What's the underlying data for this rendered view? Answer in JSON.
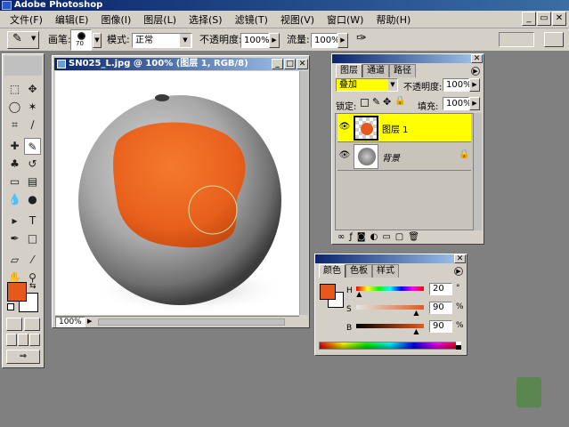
{
  "app": {
    "title": "Adobe Photoshop"
  },
  "menu": [
    "文件(F)",
    "编辑(E)",
    "图像(I)",
    "图层(L)",
    "选择(S)",
    "滤镜(T)",
    "视图(V)",
    "窗口(W)",
    "帮助(H)"
  ],
  "options": {
    "brush_label": "画笔:",
    "brush_size": "70",
    "mode_label": "模式:",
    "mode_value": "正常",
    "opacity_label": "不透明度:",
    "opacity_value": "100%",
    "flow_label": "流量:",
    "flow_value": "100%"
  },
  "document": {
    "title": "SN025_L.jpg @ 100% (图层 1, RGB/8)",
    "zoom": "100%"
  },
  "layers_panel": {
    "tabs": [
      "图层",
      "通道",
      "路径"
    ],
    "blend_mode": "叠加",
    "opacity_label": "不透明度:",
    "opacity_value": "100%",
    "lock_label": "锁定:",
    "fill_label": "填充:",
    "fill_value": "100%",
    "layers": [
      {
        "name": "图层 1",
        "selected": true
      },
      {
        "name": "背景",
        "selected": false
      }
    ]
  },
  "color_panel": {
    "tabs": [
      "颜色",
      "色板",
      "样式"
    ],
    "h_label": "H",
    "h_value": "20",
    "h_unit": "°",
    "s_label": "S",
    "s_value": "90",
    "s_unit": "%",
    "b_label": "B",
    "b_value": "90",
    "b_unit": "%",
    "h_level": 0.056,
    "s_level": 0.9,
    "b_level": 0.9
  },
  "colors": {
    "foreground": "#e55a1c",
    "background": "#ffffff",
    "selection_highlight": "#ffff00",
    "orange_paint": "#f26419"
  }
}
